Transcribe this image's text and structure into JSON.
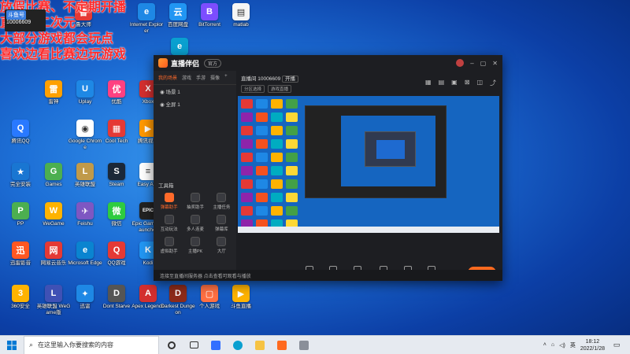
{
  "desktop": {
    "icons": [
      {
        "label": "腾讯QQ",
        "color": "#1d9bf0",
        "glyph": "Q"
      },
      {
        "label": "鲁大师",
        "color": "#e53935",
        "glyph": "鲁"
      },
      {
        "label": "Internet Explorer",
        "color": "#1e88e5",
        "glyph": "e"
      },
      {
        "label": "百度网盘",
        "color": "#2196f3",
        "glyph": "云"
      },
      {
        "label": "BitTorrent",
        "color": "#7c4dff",
        "glyph": "B"
      },
      {
        "label": "matlab",
        "color": "#f5f5f5",
        "glyph": "▤"
      },
      {
        "label": "Microsoft Edge",
        "color": "#0aa0d0",
        "glyph": "e"
      },
      {
        "label": "雷神",
        "color": "#ffa000",
        "glyph": "雷"
      },
      {
        "label": "Uplay",
        "color": "#1e88e5",
        "glyph": "U"
      },
      {
        "label": "优酷",
        "color": "#ff4081",
        "glyph": "优"
      },
      {
        "label": "Xbox",
        "color": "#d32f2f",
        "glyph": "X"
      },
      {
        "label": "腾讯QQ",
        "color": "#2979ff",
        "glyph": "Q"
      },
      {
        "label": "Google Chrome",
        "color": "#ffffff",
        "glyph": "◉"
      },
      {
        "label": "Cool Tech",
        "color": "#e53935",
        "glyph": "▦"
      },
      {
        "label": "腾讯视频",
        "color": "#ff9800",
        "glyph": "▶"
      },
      {
        "label": "完全安装",
        "color": "#1976d2",
        "glyph": "★"
      },
      {
        "label": "Games",
        "color": "#4caf50",
        "glyph": "G"
      },
      {
        "label": "英雄联盟",
        "color": "#c09a4a",
        "glyph": "L"
      },
      {
        "label": "Steam",
        "color": "#1b2838",
        "glyph": "S"
      },
      {
        "label": "Easy Anti",
        "color": "#ffffff",
        "glyph": "≡"
      },
      {
        "label": "PP",
        "color": "#4caf50",
        "glyph": "P"
      },
      {
        "label": "WeGame",
        "color": "#ffb300",
        "glyph": "W"
      },
      {
        "label": "Feishu",
        "color": "#7e57c2",
        "glyph": "✈"
      },
      {
        "label": "微信",
        "color": "#2ecc40",
        "glyph": "微"
      },
      {
        "label": "Epic Games Launcher",
        "color": "#222222",
        "glyph": "EPIC"
      },
      {
        "label": "迅雷影音",
        "color": "#ff5722",
        "glyph": "迅"
      },
      {
        "label": "网易云音乐",
        "color": "#e53935",
        "glyph": "网"
      },
      {
        "label": "Microsoft Edge",
        "color": "#0a84d0",
        "glyph": "e"
      },
      {
        "label": "QQ游戏",
        "color": "#e53935",
        "glyph": "Q"
      },
      {
        "label": "Kodi",
        "color": "#2196f3",
        "glyph": "K"
      },
      {
        "label": "360安全",
        "color": "#ffb300",
        "glyph": "3"
      },
      {
        "label": "英雄联盟 WeGame版",
        "color": "#3f51b5",
        "glyph": "L"
      },
      {
        "label": "迅雷",
        "color": "#1e88e5",
        "glyph": "✦"
      },
      {
        "label": "Dont Starve",
        "color": "#555555",
        "glyph": "D"
      },
      {
        "label": "Apex Legends",
        "color": "#d32f2f",
        "glyph": "A"
      },
      {
        "label": "Darkest Dungeon",
        "color": "#8d2b1a",
        "glyph": "D"
      },
      {
        "label": "个人游戏",
        "color": "#ff7043",
        "glyph": "▢"
      },
      {
        "label": "斗鱼直播",
        "color": "#ffb300",
        "glyph": "▶"
      }
    ]
  },
  "overlay": {
    "lines": [
      "放假比赛、不定期开播",
      "直播间二次元",
      "大部分游戏都会玩点",
      "喜欢边看比赛边玩游戏"
    ],
    "room_badge": "10006609",
    "room_tag": "斗鱼号"
  },
  "app": {
    "title": "直播伴侣",
    "version_pill": "官方",
    "left_tabs": [
      "我的场景",
      "游戏",
      "手游",
      "摄像"
    ],
    "scenes": [
      "场景 1",
      "全屏 1"
    ],
    "tools_header": "工具箱",
    "tools": [
      {
        "label": "弹幕助手",
        "hot": true
      },
      {
        "label": "抽奖助手",
        "hot": false
      },
      {
        "label": "主播任务",
        "hot": false
      },
      {
        "label": "互动玩法",
        "hot": false
      },
      {
        "label": "多人连麦",
        "hot": false
      },
      {
        "label": "弹幕库",
        "hot": false
      },
      {
        "label": "虚拟助手",
        "hot": false
      },
      {
        "label": "主播PK",
        "hot": false
      },
      {
        "label": "大厅",
        "hot": false
      }
    ],
    "bottom_note": "连接至直播间服务器 点击查看可观看与播放",
    "room_line": "直播间 10006609",
    "room_badge2": "开播",
    "chips": [
      "分区选择",
      "游戏直播"
    ],
    "controls": [
      "添加素材",
      "录制",
      "手机直播",
      "多媒体",
      "麦克风",
      "扬声器"
    ],
    "start_button": "开始直播"
  },
  "taskbar": {
    "search_placeholder": "在这里输入你要搜索的内容",
    "tray_lang": "英",
    "time": "18:12",
    "date": "2022/1/28"
  }
}
